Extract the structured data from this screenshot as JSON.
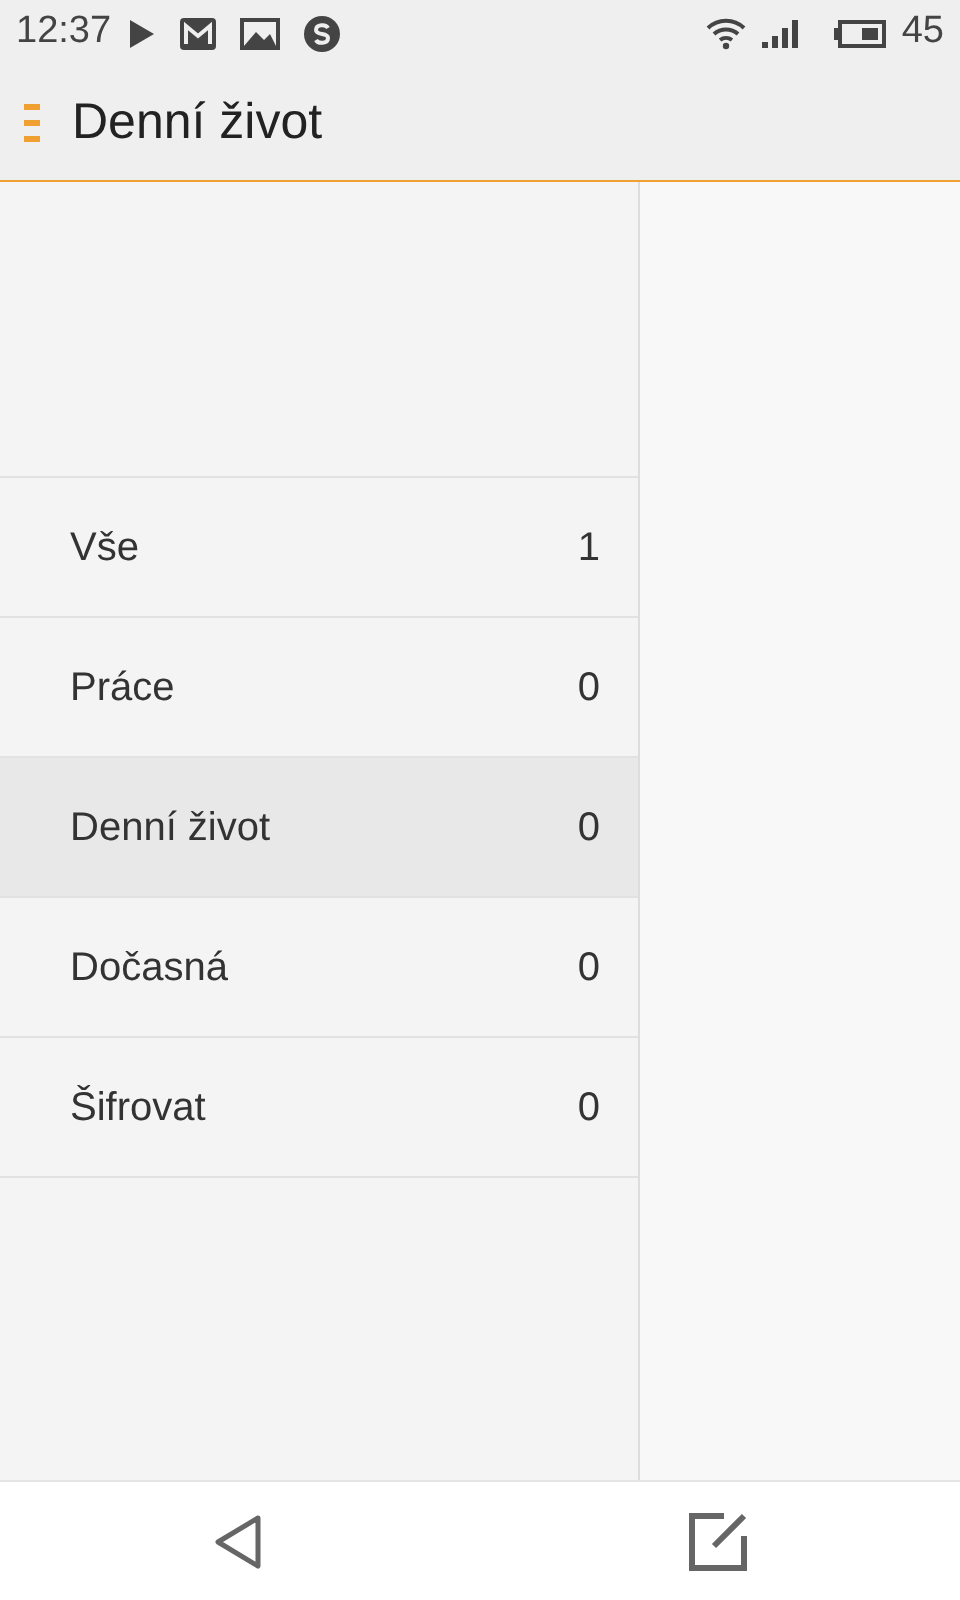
{
  "status_bar": {
    "time": "12:37",
    "battery": "45"
  },
  "header": {
    "title": "Denní život"
  },
  "categories": [
    {
      "name": "Vše",
      "count": "1",
      "selected": false
    },
    {
      "name": "Práce",
      "count": "0",
      "selected": false
    },
    {
      "name": "Denní život",
      "count": "0",
      "selected": true
    },
    {
      "name": "Dočasná",
      "count": "0",
      "selected": false
    },
    {
      "name": "Šifrovat",
      "count": "0",
      "selected": false
    }
  ]
}
